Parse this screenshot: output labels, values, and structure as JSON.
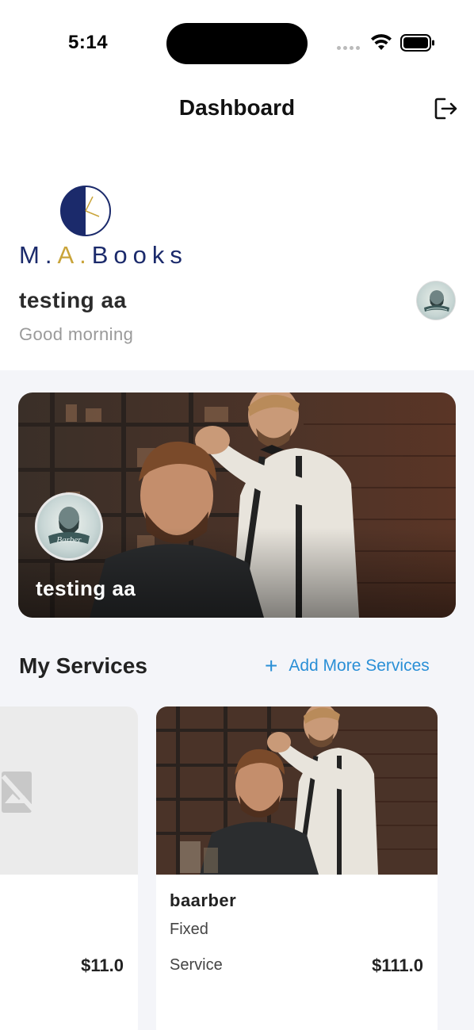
{
  "status_bar": {
    "time": "5:14"
  },
  "header": {
    "title": "Dashboard",
    "logout_icon": "logout-icon"
  },
  "brand": {
    "logo_text_1": "M.",
    "logo_text_2": "A.",
    "logo_text_3": "Books",
    "logo_icon": "clock-logo-icon"
  },
  "profile": {
    "name": "testing aa",
    "greeting": "Good morning"
  },
  "banner": {
    "shop_name": "testing aa"
  },
  "services_section": {
    "title": "My Services",
    "add_label": "Add More Services",
    "add_icon": "plus-icon"
  },
  "services": [
    {
      "name": "",
      "type": "",
      "label": "",
      "price": "$11.0",
      "image": "image-placeholder-icon"
    },
    {
      "name": "baarber",
      "type": "Fixed",
      "label": "Service",
      "price": "$111.0"
    }
  ],
  "colors": {
    "accent": "#2a8fd6",
    "brand_navy": "#1b2a6b",
    "brand_gold": "#c9a43a",
    "background": "#f4f5f9"
  }
}
